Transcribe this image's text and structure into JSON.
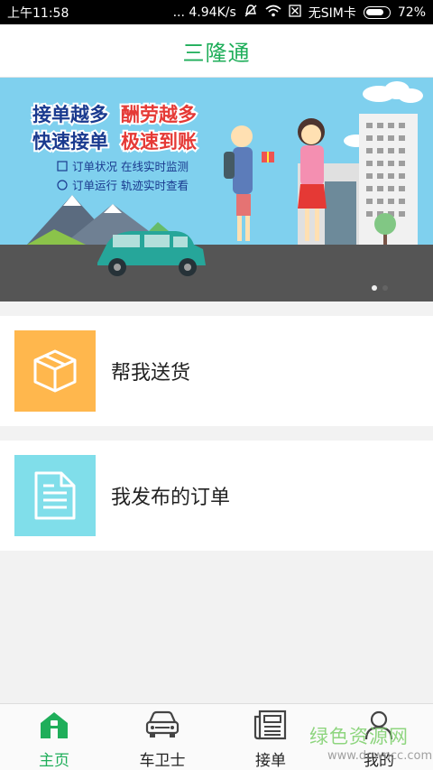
{
  "status_bar": {
    "time": "上午11:58",
    "speed": "... 4.94K/s",
    "sim": "无SIM卡",
    "battery": "72%"
  },
  "header": {
    "title": "三隆通"
  },
  "banner": {
    "line1_left": "接单越多",
    "line1_right": "酬劳越多",
    "line2_left": "快速接单",
    "line2_right": "极速到账",
    "feature1": "订单状况 在线实时监测",
    "feature2": "订单运行 轨迹实时查看"
  },
  "menu": [
    {
      "label": "帮我送货",
      "icon": "package-icon",
      "color": "#ffb74d"
    },
    {
      "label": "我发布的订单",
      "icon": "document-icon",
      "color": "#80deea"
    }
  ],
  "tabs": [
    {
      "label": "主页",
      "icon": "home-icon",
      "active": true
    },
    {
      "label": "车卫士",
      "icon": "car-icon",
      "active": false
    },
    {
      "label": "接单",
      "icon": "newspaper-icon",
      "active": false
    },
    {
      "label": "我的",
      "icon": "person-icon",
      "active": false
    }
  ],
  "watermark": {
    "line1": "绿色资源网",
    "line2": "www.downcc.com"
  },
  "colors": {
    "brand_green": "#1fae5a",
    "banner_sky": "#7fd0ee",
    "road": "#555555"
  }
}
